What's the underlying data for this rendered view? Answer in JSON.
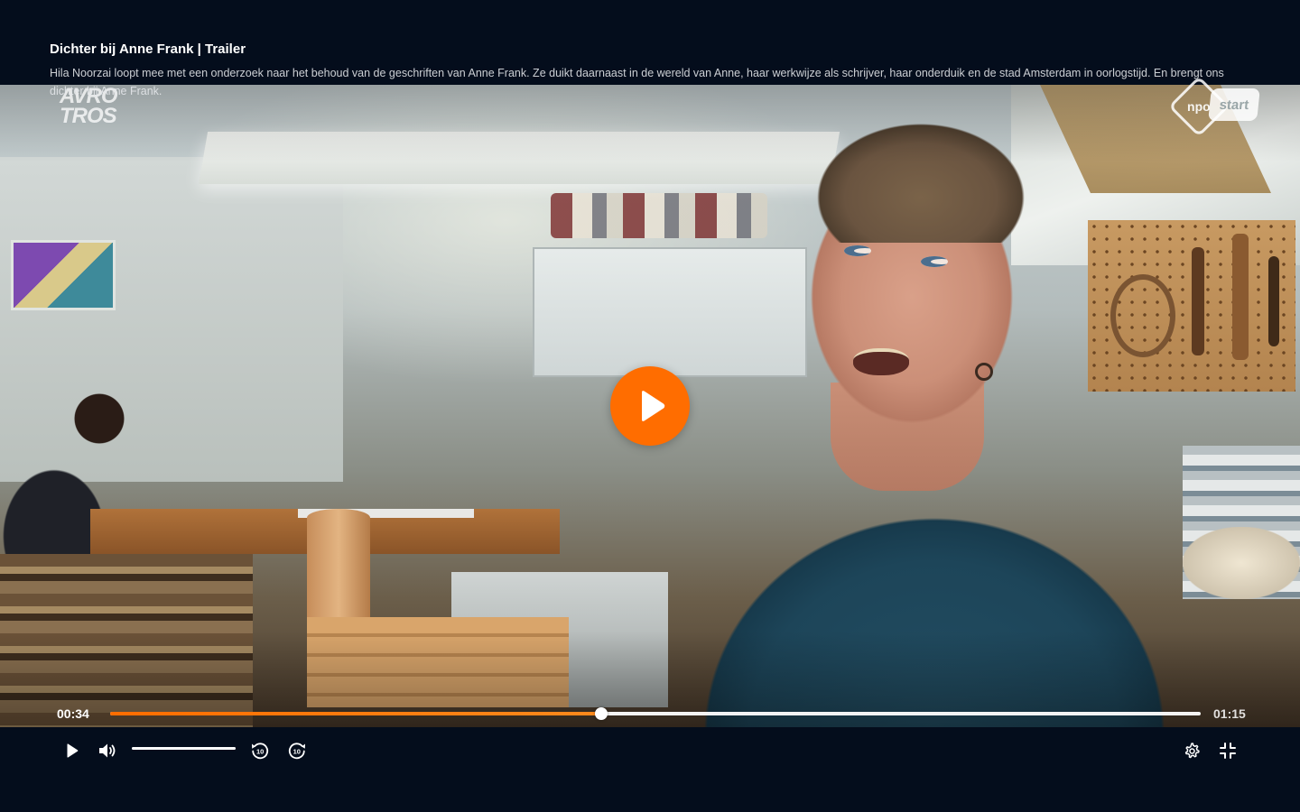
{
  "header": {
    "title": "Dichter bij Anne Frank | Trailer",
    "description": "Hila Noorzai loopt mee met een onderzoek naar het behoud van de geschriften van Anne Frank. Ze duikt daarnaast in de wereld van Anne, haar werkwijze als schrijver, haar onderduik en de stad Amsterdam in oorlogstijd. En brengt ons dichter bij Anne Frank."
  },
  "video": {
    "broadcaster_logo": {
      "line1": "AVRO",
      "line2": "TROS",
      "small": "o"
    },
    "channel_logo": {
      "npo": "npo",
      "start": "start"
    }
  },
  "player": {
    "current_time": "00:34",
    "total_time": "01:15",
    "progress_fraction": 0.45,
    "volume_fraction": 1.0,
    "accent_color": "#ff6d00",
    "background_color": "#040d1c"
  },
  "controls": {
    "play_icon": "play-icon",
    "volume_icon": "volume-icon",
    "rewind_icon": "rewind-10-icon",
    "forward_icon": "forward-10-icon",
    "rewind_seconds": "10",
    "forward_seconds": "10",
    "settings_icon": "gear-icon",
    "exit_fullscreen_icon": "exit-fullscreen-icon"
  }
}
